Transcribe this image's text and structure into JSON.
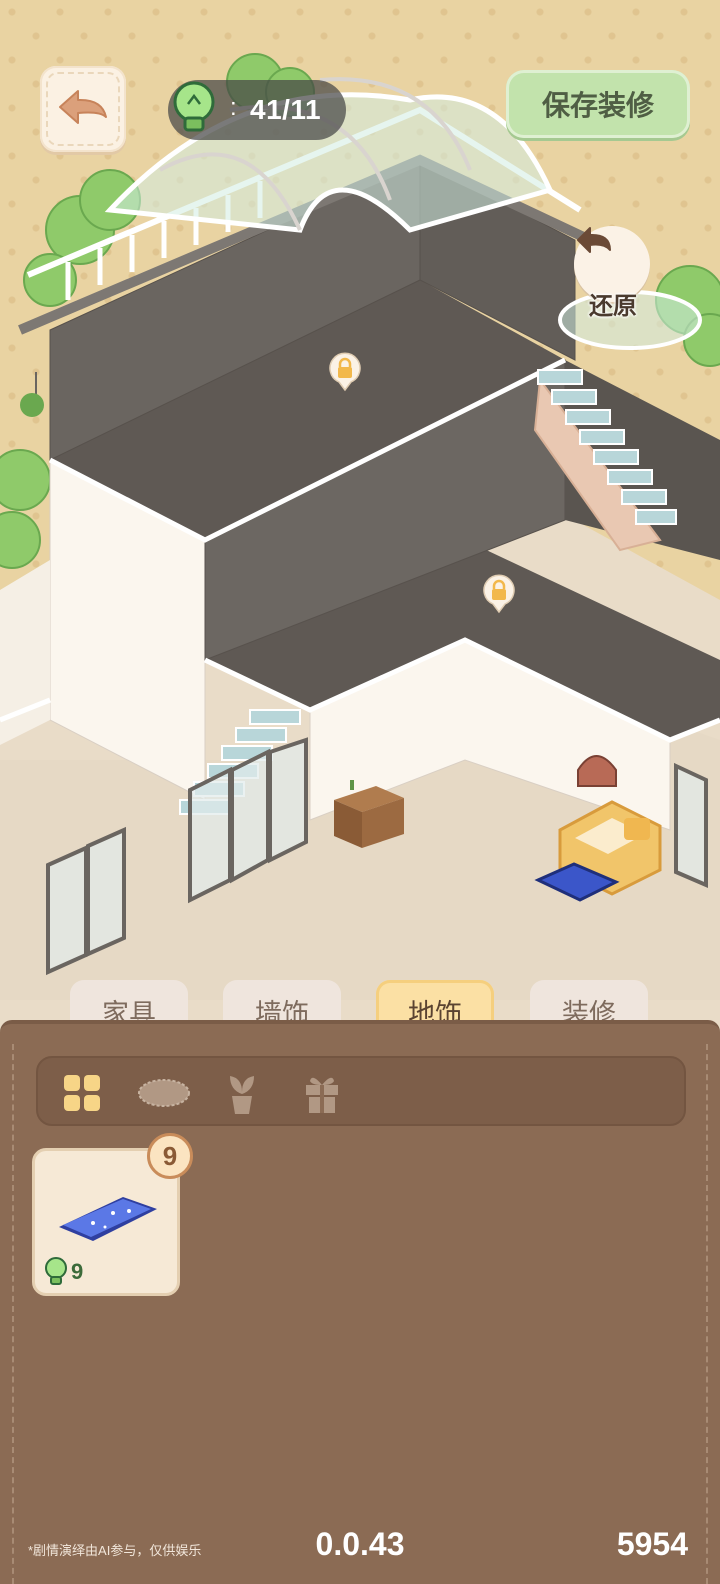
{
  "hud": {
    "energy_value": "41/11",
    "energy_separator": ":",
    "save_button_label": "保存装修",
    "restore_label": "还原"
  },
  "tabs": [
    {
      "label": "家具",
      "active": false
    },
    {
      "label": "墙饰",
      "active": false
    },
    {
      "label": "地饰",
      "active": true
    },
    {
      "label": "装修",
      "active": false
    }
  ],
  "subtabs": [
    "grid-icon",
    "rug-icon",
    "plant-icon",
    "gift-icon"
  ],
  "inventory": [
    {
      "name": "blue-starry-rug",
      "count": "9",
      "cost": "9"
    }
  ],
  "footer": {
    "disclaimer": "*剧情演绎由AI参与，仅供娱乐",
    "version": "0.0.43",
    "score": "5954"
  },
  "colors": {
    "panel": "#8b6b54",
    "active_tab": "#fbe0a4",
    "save_button": "#c2e3ac"
  }
}
